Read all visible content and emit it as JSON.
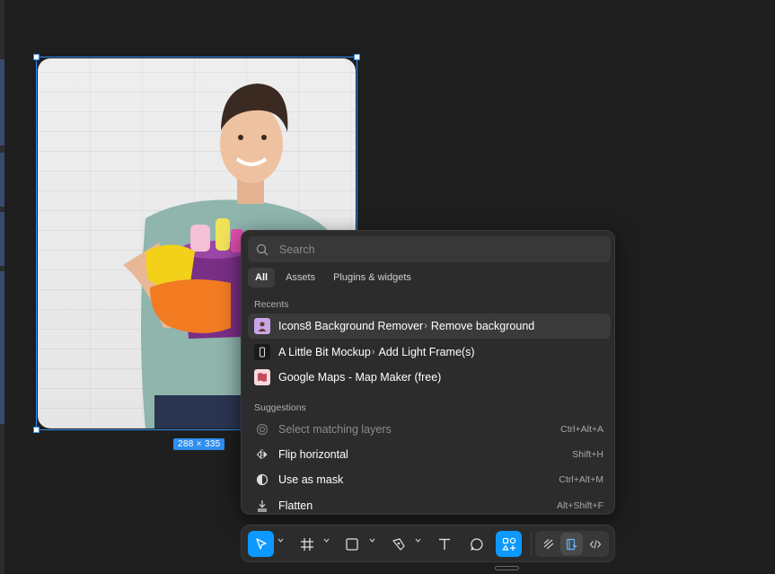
{
  "canvas": {
    "selection_size": "288 × 335"
  },
  "quick_actions": {
    "search_placeholder": "Search",
    "tabs": [
      {
        "label": "All",
        "active": true
      },
      {
        "label": "Assets",
        "active": false
      },
      {
        "label": "Plugins & widgets",
        "active": false
      }
    ],
    "recents_label": "Recents",
    "recents": [
      {
        "plugin": "Icons8 Background Remover",
        "command": "Remove background"
      },
      {
        "plugin": "A Little Bit Mockup",
        "command": "Add Light Frame(s)"
      },
      {
        "plugin": "Google Maps - Map Maker (free)",
        "command": ""
      }
    ],
    "separator": "›",
    "suggestions_label": "Suggestions",
    "suggestions": [
      {
        "label": "Select matching layers",
        "shortcut": "Ctrl+Alt+A",
        "disabled": true,
        "icon": "target-icon"
      },
      {
        "label": "Flip horizontal",
        "shortcut": "Shift+H",
        "disabled": false,
        "icon": "flip-horizontal-icon"
      },
      {
        "label": "Use as mask",
        "shortcut": "Ctrl+Alt+M",
        "disabled": false,
        "icon": "mask-icon"
      },
      {
        "label": "Flatten",
        "shortcut": "Alt+Shift+F",
        "disabled": false,
        "icon": "flatten-icon"
      }
    ]
  },
  "toolbar": {
    "tools": [
      "move-tool",
      "frame-tool",
      "shape-tool",
      "pen-tool",
      "text-tool",
      "comment-tool",
      "actions-tool",
      "draw-mode",
      "design-mode",
      "dev-mode"
    ],
    "accent_color": "#0d99ff"
  }
}
